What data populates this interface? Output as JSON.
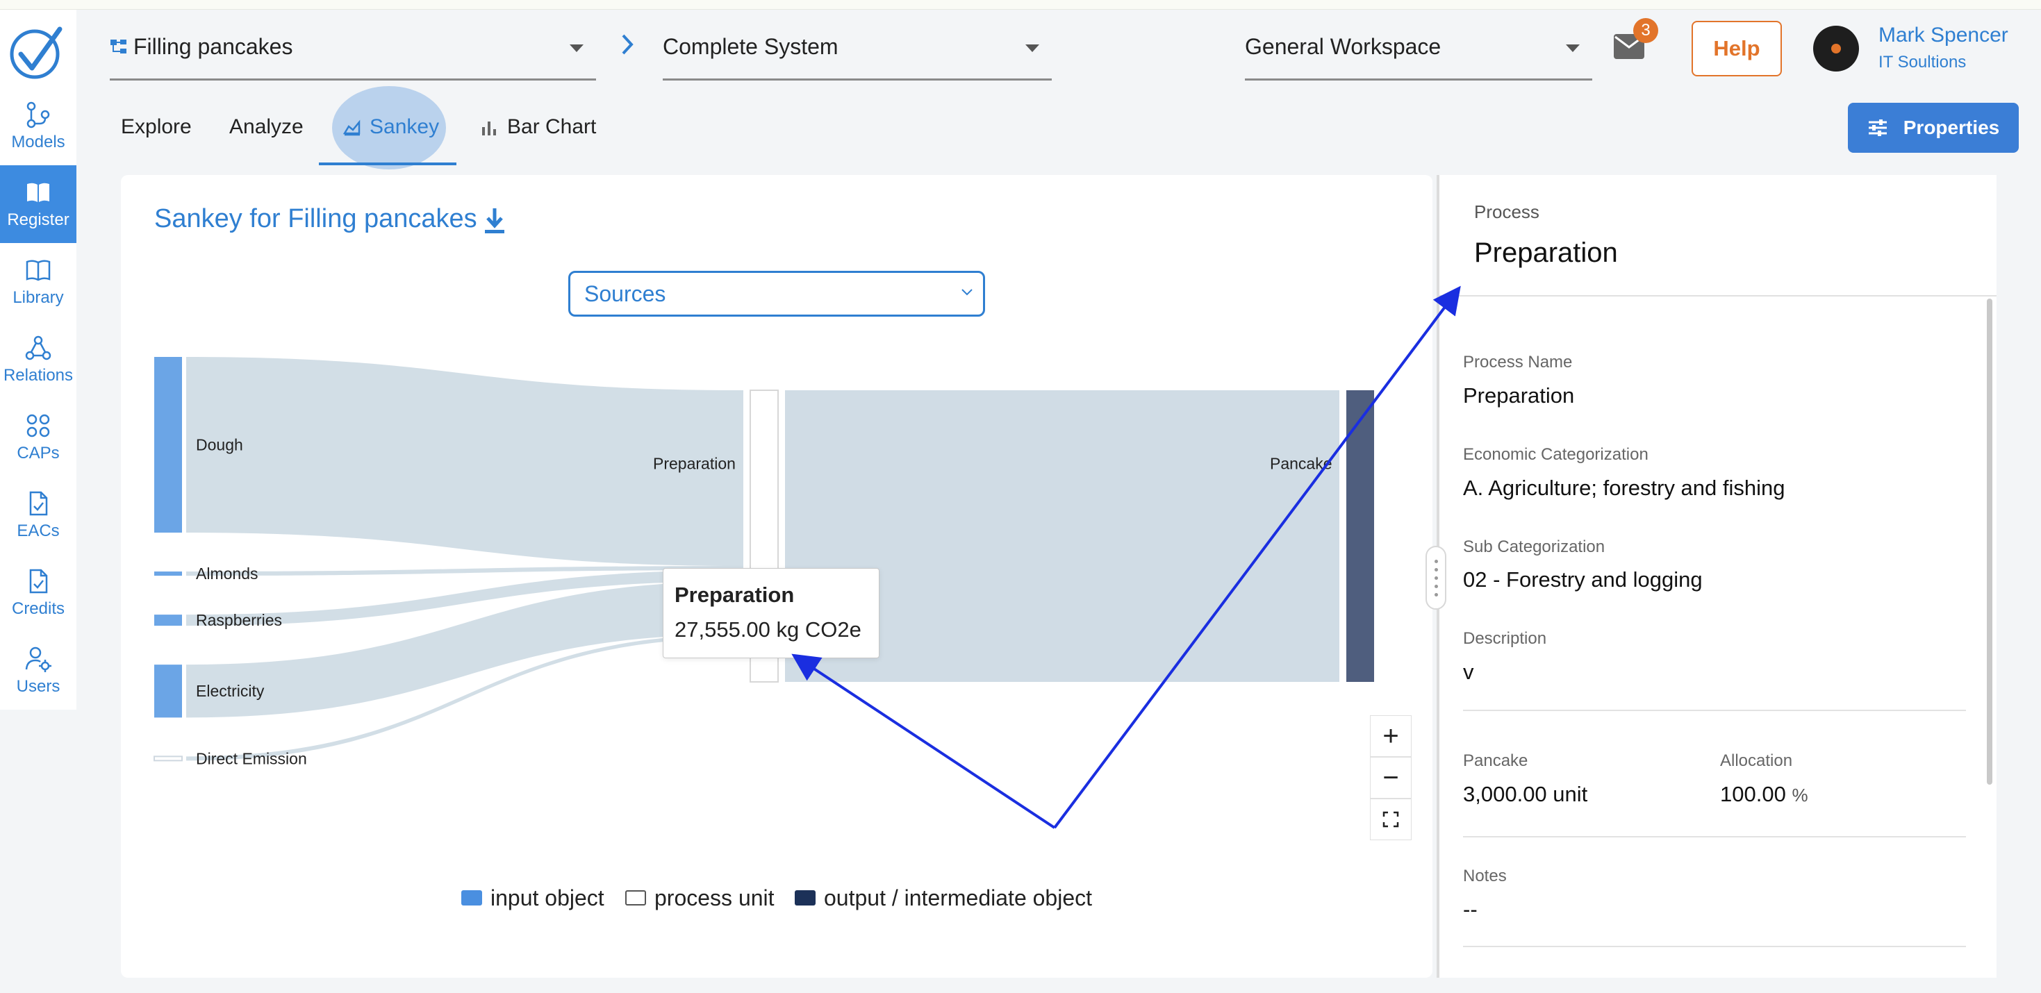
{
  "colors": {
    "accent": "#2f7fd1",
    "active_nav": "#3d8be0",
    "help": "#e2742a",
    "input_object": "#6ba5e6",
    "output_object": "#4f5e7e",
    "link": "#d0dce5",
    "annotation_arrow": "#1a2ee0"
  },
  "sidebar": {
    "items": [
      {
        "label": "Models",
        "icon": "models-icon"
      },
      {
        "label": "Register",
        "icon": "book-icon",
        "active": true
      },
      {
        "label": "Library",
        "icon": "open-book-icon"
      },
      {
        "label": "Relations",
        "icon": "relations-icon"
      },
      {
        "label": "CAPs",
        "icon": "grid-icon"
      },
      {
        "label": "EACs",
        "icon": "document-check-icon"
      },
      {
        "label": "Credits",
        "icon": "document-check-icon"
      },
      {
        "label": "Users",
        "icon": "user-settings-icon"
      }
    ]
  },
  "header": {
    "model_select": "Filling pancakes",
    "system_select": "Complete System",
    "workspace_select": "General Workspace",
    "notifications_count": "3",
    "help_label": "Help",
    "user_name": "Mark Spencer",
    "user_org": "IT Soultions"
  },
  "tabs": [
    {
      "label": "Explore"
    },
    {
      "label": "Analyze"
    },
    {
      "label": "Sankey",
      "active": true
    },
    {
      "label": "Bar Chart"
    }
  ],
  "properties_button": "Properties",
  "main": {
    "title": "Sankey for Filling pancakes",
    "mode_select": "Sources",
    "legend": [
      {
        "label": "input object",
        "color": "#4a8fe0"
      },
      {
        "label": "process unit",
        "color": "#ffffff"
      },
      {
        "label": "output / intermediate object",
        "color": "#1c3158"
      }
    ],
    "tooltip": {
      "title": "Preparation",
      "value": "27,555.00 kg CO2e"
    }
  },
  "chart_data": {
    "type": "sankey",
    "nodes": [
      {
        "name": "Dough",
        "kind": "input object"
      },
      {
        "name": "Almonds",
        "kind": "input object"
      },
      {
        "name": "Raspberries",
        "kind": "input object"
      },
      {
        "name": "Electricity",
        "kind": "input object"
      },
      {
        "name": "Direct Emission",
        "kind": "input object"
      },
      {
        "name": "Preparation",
        "kind": "process unit"
      },
      {
        "name": "Pancake",
        "kind": "output / intermediate object"
      }
    ],
    "links": [
      {
        "source": "Dough",
        "target": "Preparation",
        "value": 16600
      },
      {
        "source": "Almonds",
        "target": "Preparation",
        "value": 400
      },
      {
        "source": "Raspberries",
        "target": "Preparation",
        "value": 1050
      },
      {
        "source": "Electricity",
        "target": "Preparation",
        "value": 5000
      },
      {
        "source": "Direct Emission",
        "target": "Preparation",
        "value": 350
      },
      {
        "source": "Preparation",
        "target": "Pancake",
        "value": 27555
      }
    ],
    "total": 27555,
    "unit": "kg CO2e"
  },
  "panel": {
    "section": "Process",
    "title": "Preparation",
    "fields": {
      "process_name_label": "Process Name",
      "process_name": "Preparation",
      "econ_label": "Economic Categorization",
      "econ": "A. Agriculture; forestry and fishing",
      "sub_label": "Sub Categorization",
      "sub": "02 - Forestry and logging",
      "desc_label": "Description",
      "desc": "v",
      "output_label": "Pancake",
      "output_value": "3,000.00 unit",
      "alloc_label": "Allocation",
      "alloc_value": "100.00",
      "alloc_unit": "%",
      "notes_label": "Notes",
      "notes": "--"
    }
  }
}
